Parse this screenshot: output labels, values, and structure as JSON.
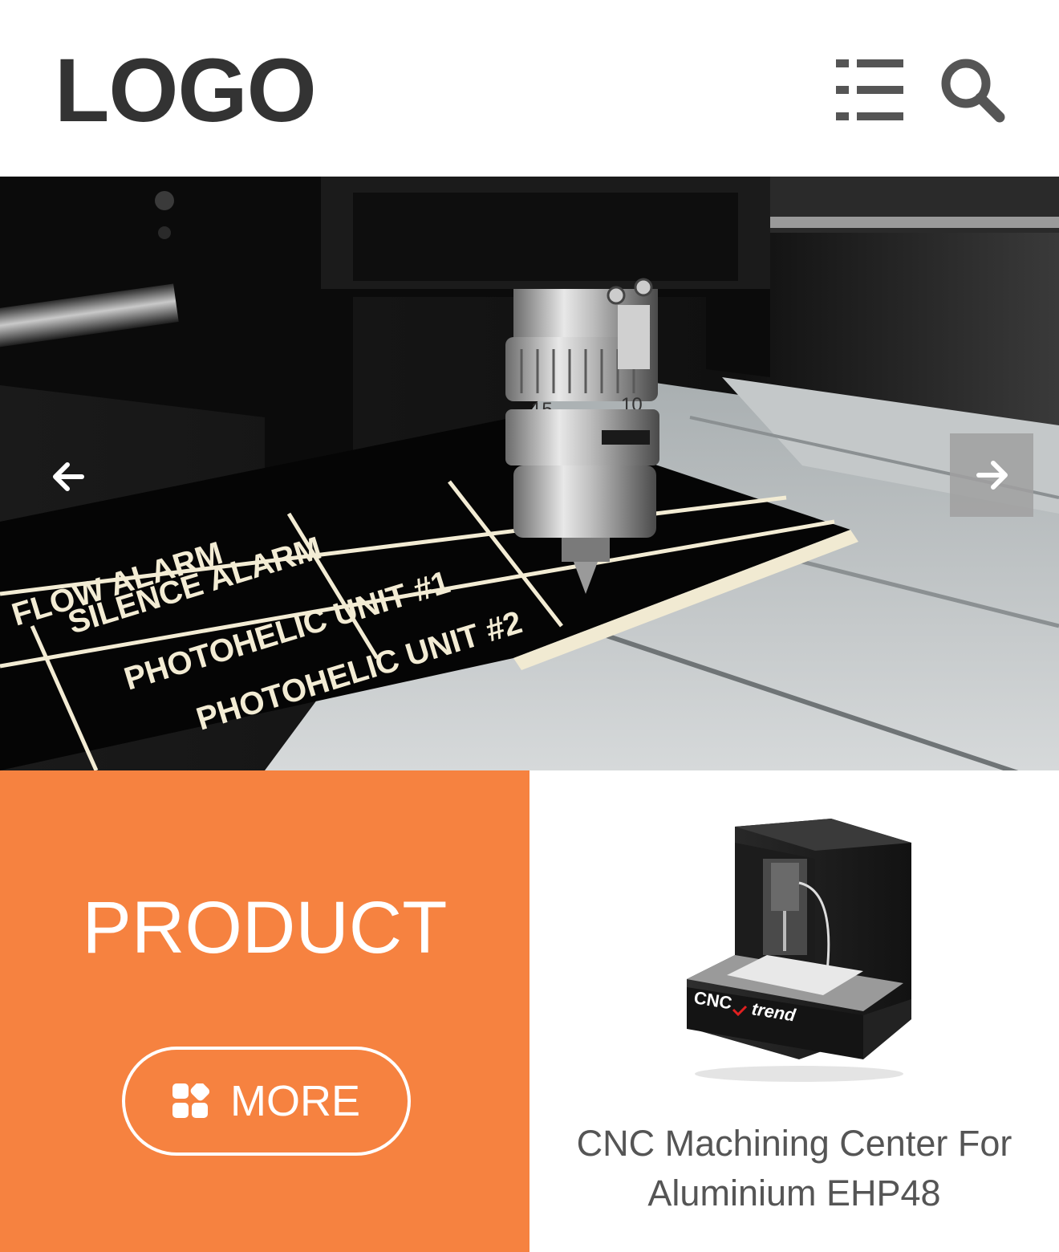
{
  "header": {
    "logo_text": "LOGO",
    "menu_icon": "list-menu-icon",
    "search_icon": "search-icon"
  },
  "hero": {
    "prev_icon": "arrow-left-icon",
    "next_icon": "arrow-right-icon",
    "engraved_labels": [
      "FLOW ALARM",
      "SILENCE ALARM",
      "PHOTOHELIC UNIT #1",
      "PHOTOHELIC UNIT #2"
    ],
    "dial_numbers": [
      "15",
      "10"
    ]
  },
  "product_panel": {
    "title": "PRODUCT",
    "more_label": "MORE",
    "more_icon": "grid-apps-icon",
    "background_color": "#f68240"
  },
  "product_card": {
    "name": "CNC Machining Center For Aluminium EHP48",
    "image_brand_left": "CNC",
    "image_brand_right": "trend"
  }
}
